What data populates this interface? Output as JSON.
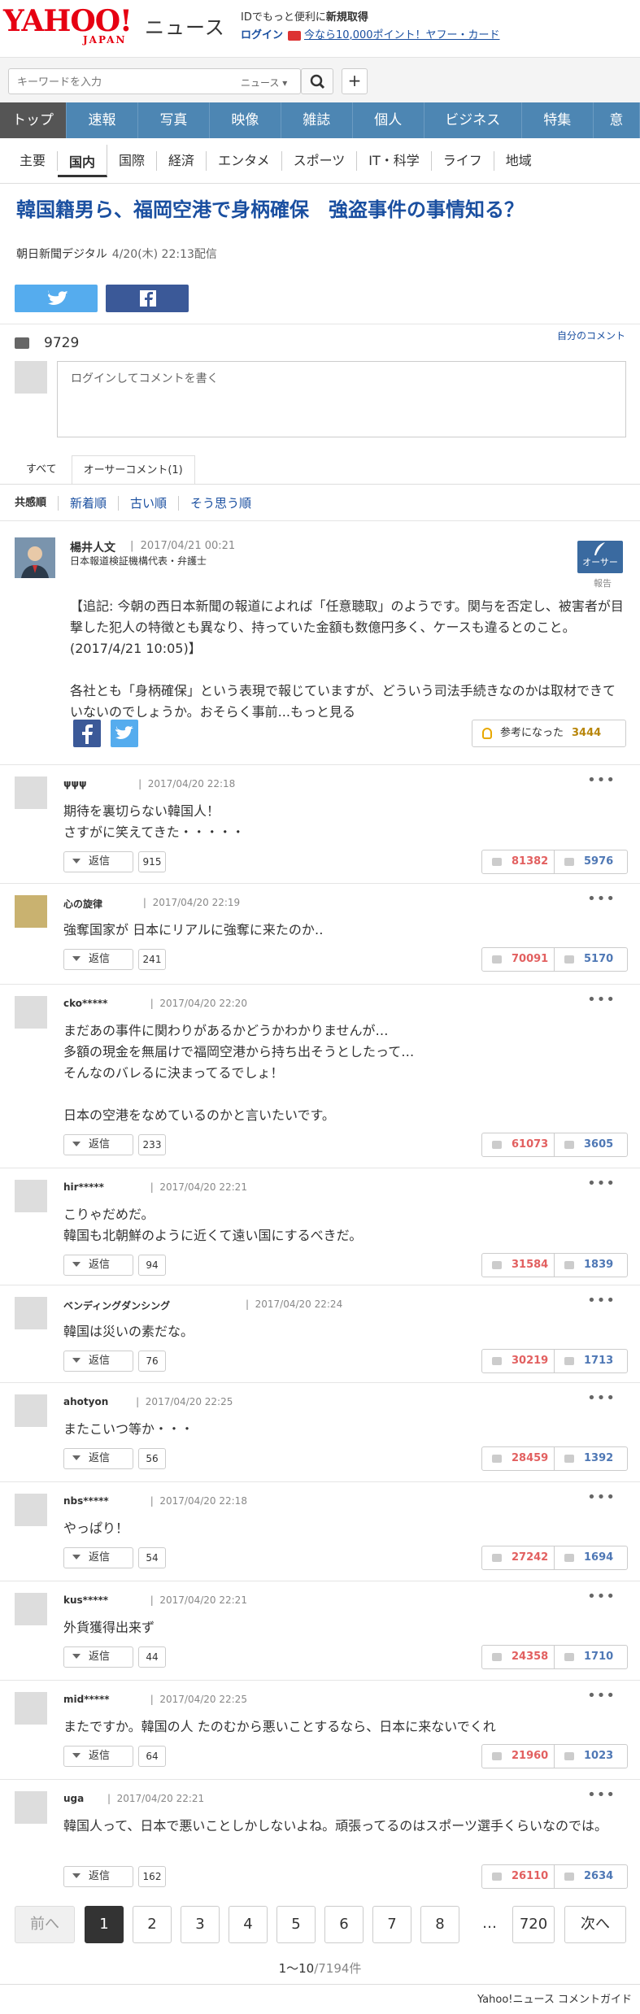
{
  "header": {
    "logo_main": "YAHOO!",
    "logo_sub": "JAPAN",
    "service": "ニュース",
    "promo_text": "IDでもっと便利に",
    "promo_bold": "新規取得",
    "login": "ログイン",
    "point_link": "今なら10,000ポイント！ヤフー・カード"
  },
  "search": {
    "placeholder": "キーワードを入力",
    "scope": "ニュース"
  },
  "main_nav": [
    "トップ",
    "速報",
    "写真",
    "映像",
    "雑誌",
    "個人",
    "ビジネス",
    "特集",
    "意"
  ],
  "sub_nav": [
    "主要",
    "国内",
    "国際",
    "経済",
    "エンタメ",
    "スポーツ",
    "IT・科学",
    "ライフ",
    "地域"
  ],
  "article": {
    "headline": "韓国籍男ら、福岡空港で身柄確保　強盗事件の事情知る？",
    "source": "朝日新聞デジタル",
    "datetime": "4/20(木) 22:13配信"
  },
  "comments_header": {
    "count": "9729",
    "my_comments": "自分のコメント",
    "input_prompt": "ログインしてコメントを書く"
  },
  "tabs": [
    "すべて",
    "オーサーコメント(1)"
  ],
  "sort": [
    "共感順",
    "新着順",
    "古い順",
    "そう思う順"
  ],
  "owner_comment": {
    "name": "楊井人文",
    "date": "2017/04/21 00:21",
    "title": "日本報道検証機構代表・弁護士",
    "badge": "オーサー",
    "report": "報告",
    "body": "【追記: 今朝の西日本新聞の報道によれば「任意聴取」のようです。関与を否定し、被害者が目撃した犯人の特徴とも異なり、持っていた金額も数億円多く、ケースも違るとのこと。(2017/4/21 10:05)】\n\n各社とも「身柄確保」という表現で報じていますが、どういう司法手続きなのかは取材できていないのでしょうか。おそらく事前...もっと見る",
    "helpful_label": "参考になった",
    "helpful_count": "3444"
  },
  "reply_label": "返信",
  "comments": [
    {
      "user": "ψψψ",
      "date": "2017/04/20 22:18",
      "body": "期待を裏切らない韓国人！\nさすがに笑えてきた・・・・・",
      "replies": "915",
      "up": "81382",
      "down": "5976"
    },
    {
      "user": "心の旋律",
      "date": "2017/04/20 22:19",
      "body": "強奪国家が 日本にリアルに強奪に来たのか‥",
      "replies": "241",
      "up": "70091",
      "down": "5170"
    },
    {
      "user": "cko*****",
      "date": "2017/04/20 22:20",
      "body": "まだあの事件に関わりがあるかどうかわかりませんが…\n多額の現金を無届けで福岡空港から持ち出そうとしたって…\nそんなのバレるに決まってるでしょ！\n\n日本の空港をなめているのかと言いたいです。",
      "replies": "233",
      "up": "61073",
      "down": "3605"
    },
    {
      "user": "hir*****",
      "date": "2017/04/20 22:21",
      "body": "こりゃだめだ。\n韓国も北朝鮮のように近くて遠い国にするべきだ。",
      "replies": "94",
      "up": "31584",
      "down": "1839"
    },
    {
      "user": "ベンディングダンシング",
      "date": "2017/04/20 22:24",
      "body": "韓国は災いの素だな。",
      "replies": "76",
      "up": "30219",
      "down": "1713"
    },
    {
      "user": "ahotyon",
      "date": "2017/04/20 22:25",
      "body": "またこいつ等か・・・",
      "replies": "56",
      "up": "28459",
      "down": "1392"
    },
    {
      "user": "nbs*****",
      "date": "2017/04/20 22:18",
      "body": "やっぱり！",
      "replies": "54",
      "up": "27242",
      "down": "1694"
    },
    {
      "user": "kus*****",
      "date": "2017/04/20 22:21",
      "body": "外貨獲得出来ず",
      "replies": "44",
      "up": "24358",
      "down": "1710"
    },
    {
      "user": "mid*****",
      "date": "2017/04/20 22:25",
      "body": "またですか。韓国の人 たのむから悪いことするなら、日本に来ないでくれ",
      "replies": "64",
      "up": "21960",
      "down": "1023"
    },
    {
      "user": "uga",
      "date": "2017/04/20 22:21",
      "body": "韓国人って、日本で悪いことしかしないよね。頑張ってるのはスポーツ選手くらいなのでは。",
      "replies": "162",
      "up": "26110",
      "down": "2634"
    }
  ],
  "pager": {
    "prev": "前へ",
    "pages": [
      "1",
      "2",
      "3",
      "4",
      "5",
      "6",
      "7",
      "8"
    ],
    "dots": "…",
    "last": "720",
    "next": "次へ",
    "range": "1〜10",
    "total": "/7194件"
  },
  "footer": {
    "link": "Yahoo!ニュース コメントガイド"
  }
}
